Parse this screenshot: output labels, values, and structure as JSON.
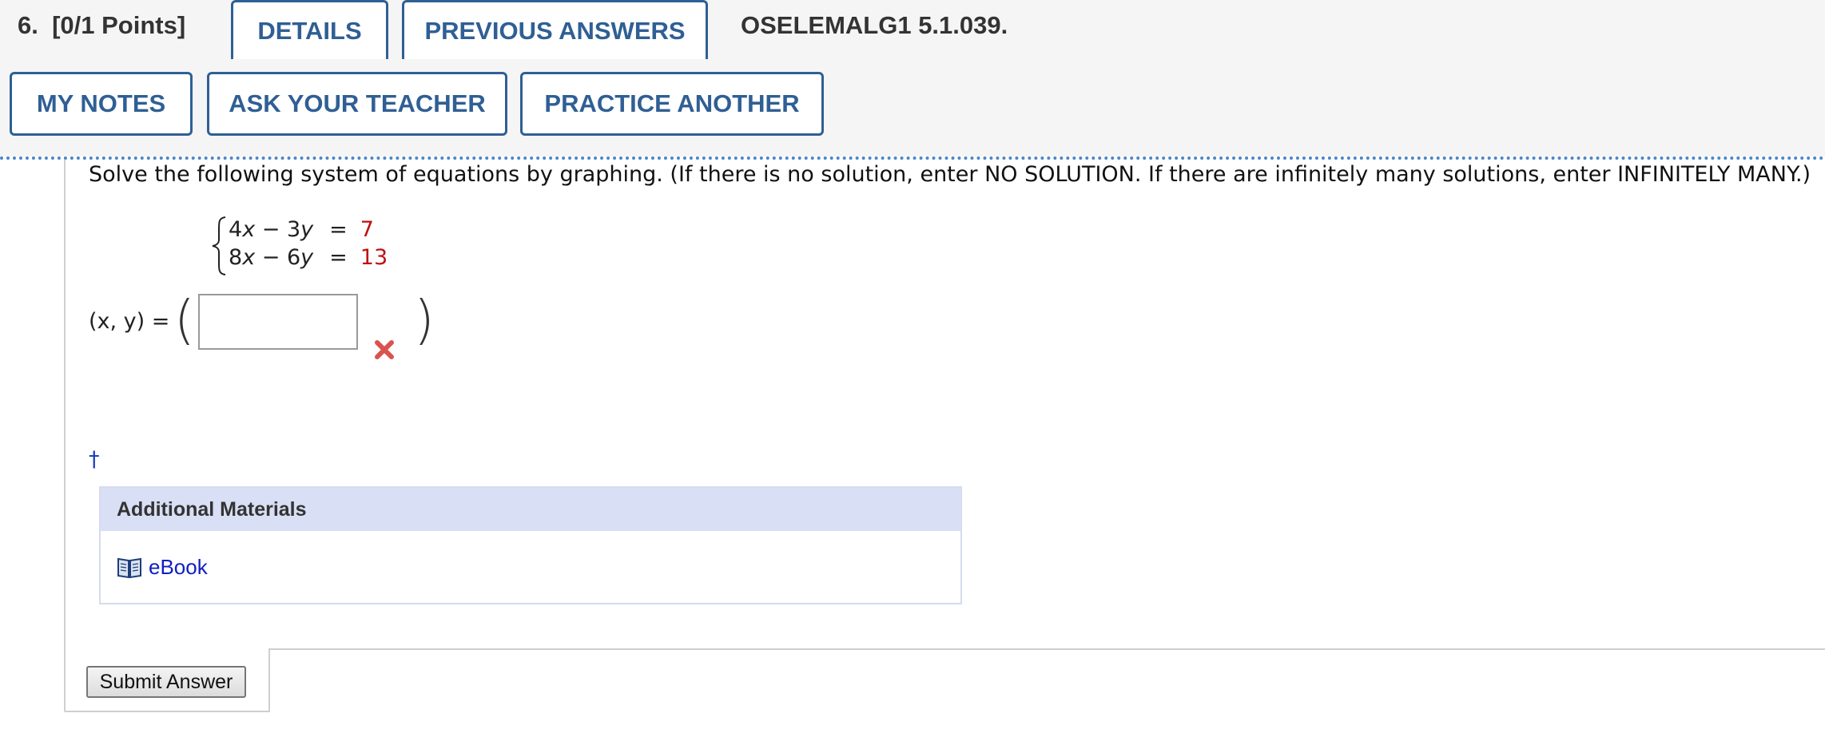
{
  "header": {
    "question_number": "6.",
    "points": "[0/1 Points]",
    "tabs": {
      "details": "DETAILS",
      "previous_answers": "PREVIOUS ANSWERS"
    },
    "problem_code": "OSELEMALG1 5.1.039.",
    "actions": {
      "my_notes": "MY NOTES",
      "ask_teacher": "ASK YOUR TEACHER",
      "practice_another": "PRACTICE ANOTHER"
    }
  },
  "problem": {
    "instructions": "Solve the following system of equations by graphing. (If there is no solution, enter NO SOLUTION. If there are infinitely many solutions, enter INFINITELY MANY.)",
    "equations": [
      {
        "a": "4",
        "b": "3",
        "c": "7"
      },
      {
        "a": "8",
        "b": "6",
        "c": "13"
      }
    ],
    "answer_label": "(x, y) =",
    "answer_value": "",
    "answer_status": "incorrect",
    "dagger": "†"
  },
  "materials": {
    "header": "Additional Materials",
    "items": [
      {
        "label": "eBook",
        "icon": "book-icon"
      }
    ]
  },
  "submit": {
    "label": "Submit Answer"
  },
  "colors": {
    "accent": "#2f5f94",
    "incorrect": "#d9534f",
    "constant_red": "#c01010",
    "materials_header_bg": "#d9dff5",
    "link": "#1020c0",
    "dotted_rule": "#4a86c8"
  }
}
